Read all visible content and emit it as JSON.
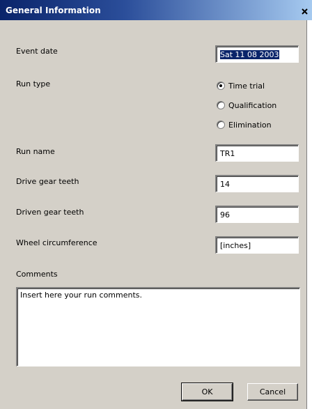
{
  "window": {
    "title": "General Information",
    "close_glyph": "×"
  },
  "form": {
    "event_date": {
      "label": "Event date",
      "value": "Sat 11 08 2003"
    },
    "run_type": {
      "label": "Run type",
      "options": [
        {
          "label": "Time trial",
          "selected": true
        },
        {
          "label": "Qualification",
          "selected": false
        },
        {
          "label": "Elimination",
          "selected": false
        }
      ]
    },
    "run_name": {
      "label": "Run name",
      "value": "TR1"
    },
    "drive_gear": {
      "label": "Drive gear teeth",
      "value": "14"
    },
    "driven_gear": {
      "label": "Driven gear teeth",
      "value": "96"
    },
    "wheel_circ": {
      "label": "Wheel circumference",
      "value": "[inches]"
    },
    "comments": {
      "label": "Comments",
      "value": "Insert here your run comments."
    }
  },
  "buttons": {
    "ok": "OK",
    "cancel": "Cancel"
  },
  "colors": {
    "titlebar_start": "#0a246a",
    "titlebar_end": "#a6caf0",
    "dialog_bg": "#d4d0c8",
    "selection_bg": "#0a246a"
  },
  "icons": {
    "close": "close-icon",
    "radio": "radio-button-icon"
  }
}
